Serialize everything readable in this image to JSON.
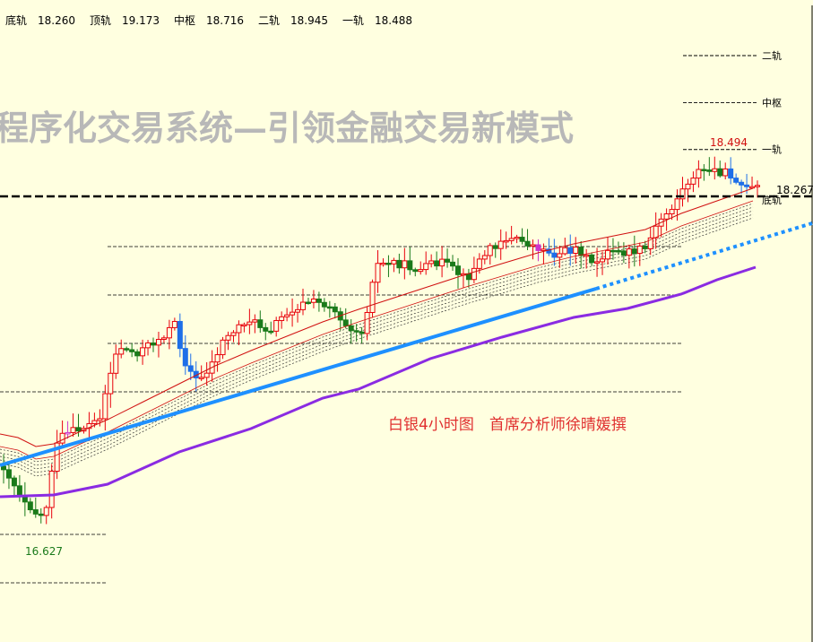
{
  "header": {
    "items": [
      {
        "label": "底轨",
        "value": "18.260"
      },
      {
        "label": "顶轨",
        "value": "19.173"
      },
      {
        "label": "中枢",
        "value": "18.716"
      },
      {
        "label": "二轨",
        "value": "18.945"
      },
      {
        "label": "一轨",
        "value": "18.488"
      }
    ]
  },
  "watermark": "程序化交易系统—引领金融交易新模式",
  "annotation": "白银4小时图　首席分析师徐晴媛撰",
  "levels": [
    {
      "label": "二轨",
      "value": 18.945
    },
    {
      "label": "中枢",
      "value": 18.716
    },
    {
      "label": "一轨",
      "value": 18.488
    },
    {
      "label": "底轨",
      "value": 18.26
    }
  ],
  "current_price": "18.267",
  "high_label": "18.494",
  "low_label": "16.627",
  "colors": {
    "up": "#e8000b",
    "down_blue": "#1e6fe8",
    "down_green": "#1a7a1a",
    "trend": "#1e90ff",
    "long_ma": "#8a2be2",
    "ma": "#d01010",
    "high_text": "#d01010",
    "low_text": "#1a7a1a",
    "background": "#ffffe0"
  },
  "chart_data": {
    "type": "candlestick",
    "title": "白银4小时图",
    "yaxis_range": [
      16.2,
      19.24
    ],
    "reference_levels": {
      "底轨": 18.26,
      "顶轨": 19.173,
      "中枢": 18.716,
      "二轨": 18.945,
      "一轨": 18.488
    },
    "current_price": 18.267,
    "annotated_high": 18.494,
    "annotated_low": 16.627
  }
}
